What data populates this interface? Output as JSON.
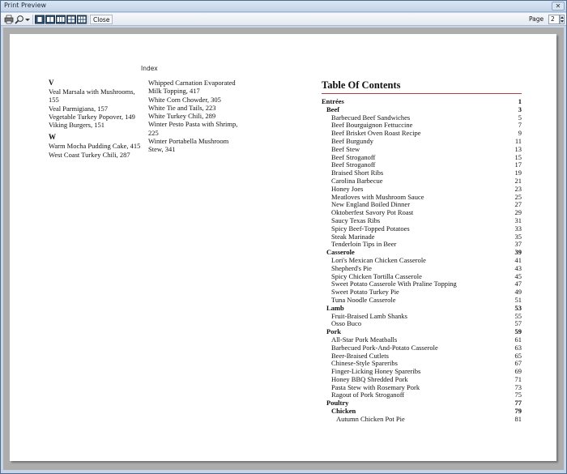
{
  "window": {
    "title": "Print Preview"
  },
  "toolbar": {
    "icons": [
      "print-icon",
      "zoom-icon",
      "dropdown-icon",
      "one-page-icon",
      "two-pages-icon",
      "three-pages-icon",
      "four-pages-icon",
      "six-pages-icon"
    ],
    "close_label": "Close",
    "page_label": "Page",
    "page_value": "2"
  },
  "index": {
    "title": "Index",
    "col1": [
      {
        "kind": "letter",
        "text": "V"
      },
      {
        "kind": "entry",
        "text": "Veal Marsala with Mushrooms, 155"
      },
      {
        "kind": "entry",
        "text": "Veal Parmigiana, 157"
      },
      {
        "kind": "entry",
        "text": "Vegetable Turkey Popover, 149"
      },
      {
        "kind": "entry",
        "text": "Viking Burgers, 151"
      },
      {
        "kind": "letter",
        "text": "W"
      },
      {
        "kind": "entry",
        "text": "Warm Mocha Pudding Cake, 415"
      },
      {
        "kind": "entry",
        "text": "West Coast Turkey Chili, 287"
      }
    ],
    "col2": [
      {
        "kind": "entry",
        "text": "Whipped Carnation Evaporated Milk Topping, 417"
      },
      {
        "kind": "entry",
        "text": "White Corn Chowder, 305"
      },
      {
        "kind": "entry",
        "text": "White Tie and Tails, 223"
      },
      {
        "kind": "entry",
        "text": "White Turkey Chili, 289"
      },
      {
        "kind": "entry",
        "text": "Winter Pesto Pasta with Shrimp, 225"
      },
      {
        "kind": "entry",
        "text": "Winter Portabella Mushroom Stew, 341"
      }
    ]
  },
  "toc": {
    "title": "Table Of Contents",
    "entries": [
      {
        "level": 0,
        "text": "Entrées",
        "page": "1"
      },
      {
        "level": 1,
        "text": "Beef",
        "page": "3"
      },
      {
        "level": 2,
        "text": "Barbecued Beef Sandwiches",
        "page": "5"
      },
      {
        "level": 2,
        "text": "Beef Bourguignon Fettuccine",
        "page": "7"
      },
      {
        "level": 2,
        "text": "Beef Brisket Oven Roast Recipe",
        "page": "9"
      },
      {
        "level": 2,
        "text": "Beef Burgundy",
        "page": "11"
      },
      {
        "level": 2,
        "text": "Beef Stew",
        "page": "13"
      },
      {
        "level": 2,
        "text": "Beef Stroganoff",
        "page": "15"
      },
      {
        "level": 2,
        "text": "Beef Stroganoff",
        "page": "17"
      },
      {
        "level": 2,
        "text": "Braised Short Ribs",
        "page": "19"
      },
      {
        "level": 2,
        "text": "Carolina Barbecue",
        "page": "21"
      },
      {
        "level": 2,
        "text": "Honey Joes",
        "page": "23"
      },
      {
        "level": 2,
        "text": "Meatloves with Mushroom Sauce",
        "page": "25"
      },
      {
        "level": 2,
        "text": "New England Boiled Dinner",
        "page": "27"
      },
      {
        "level": 2,
        "text": "Oktoberfest Savory Pot Roast",
        "page": "29"
      },
      {
        "level": 2,
        "text": "Saucy Texas Ribs",
        "page": "31"
      },
      {
        "level": 2,
        "text": "Spicy Beef-Topped Potatoes",
        "page": "33"
      },
      {
        "level": 2,
        "text": "Steak Marinade",
        "page": "35"
      },
      {
        "level": 2,
        "text": "Tenderloin Tips in Beer",
        "page": "37"
      },
      {
        "level": 1,
        "text": "Casserole",
        "page": "39"
      },
      {
        "level": 2,
        "text": "Lori's Mexican Chicken Casserole",
        "page": "41"
      },
      {
        "level": 2,
        "text": "Shepherd's Pie",
        "page": "43"
      },
      {
        "level": 2,
        "text": "Spicy Chicken Tortilla Casserole",
        "page": "45"
      },
      {
        "level": 2,
        "text": "Sweet Potato Casserole With Praline Topping",
        "page": "47"
      },
      {
        "level": 2,
        "text": "Sweet Potato Turkey Pie",
        "page": "49"
      },
      {
        "level": 2,
        "text": "Tuna Noodle Casserole",
        "page": "51"
      },
      {
        "level": 1,
        "text": "Lamb",
        "page": "53"
      },
      {
        "level": 2,
        "text": "Fruit-Braised Lamb Shanks",
        "page": "55"
      },
      {
        "level": 2,
        "text": "Osso Buco",
        "page": "57"
      },
      {
        "level": 1,
        "text": "Pork",
        "page": "59"
      },
      {
        "level": 2,
        "text": "All-Star Pork Meatballs",
        "page": "61"
      },
      {
        "level": 2,
        "text": "Barbecued Pork-And-Potato Casserole",
        "page": "63"
      },
      {
        "level": 2,
        "text": "Beer-Braised Cutlets",
        "page": "65"
      },
      {
        "level": 2,
        "text": "Chinese-Style Spareribs",
        "page": "67"
      },
      {
        "level": 2,
        "text": "Finger-Licking Honey Spareribs",
        "page": "69"
      },
      {
        "level": 2,
        "text": "Honey BBQ Shredded Pork",
        "page": "71"
      },
      {
        "level": 2,
        "text": "Pasta Stew with Rosemary Pork",
        "page": "73"
      },
      {
        "level": 2,
        "text": "Ragout of Pork Stroganoff",
        "page": "75"
      },
      {
        "level": 1,
        "text": "Poultry",
        "page": "77"
      },
      {
        "level": 3,
        "text": "Chicken",
        "page": "79"
      },
      {
        "level": 4,
        "text": "Autumn Chicken Pot Pie",
        "page": "81"
      }
    ]
  }
}
